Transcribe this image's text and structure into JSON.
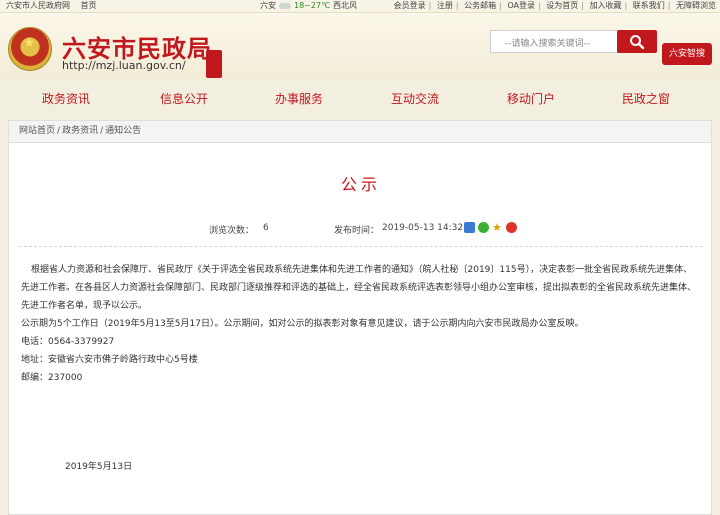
{
  "topbar": {
    "gov_site": "六安市人民政府网",
    "home": "首页",
    "city": "六安",
    "temp": "18~27℃",
    "wind": "西北风",
    "links": [
      "会员登录",
      "注册",
      "公务邮箱",
      "OA登录",
      "设为首页",
      "加入收藏",
      "联系我们",
      "无障碍浏览"
    ]
  },
  "header": {
    "title": "六安市民政局",
    "url": "http://mzj.luan.gov.cn/",
    "search_placeholder": "--请输入搜索关键词--",
    "zhitou_label": "六安智搜"
  },
  "nav": {
    "items": [
      "政务资讯",
      "信息公开",
      "办事服务",
      "互动交流",
      "移动门户",
      "民政之窗"
    ]
  },
  "breadcrumb": {
    "items": [
      "网站首页",
      "政务资讯",
      "通知公告"
    ],
    "separator": "/"
  },
  "article": {
    "title": "公示",
    "views_label": "浏览次数：",
    "views_value": "6",
    "publish_label": "发布时间：",
    "publish_value": "2019-05-13 14:32",
    "para1_line1": "根据省人力资源和社会保障厅、省民政厅《关于评选全省民政系统先进集体和先进工作者的通知》（皖人社秘〔2019〕115号），决定表彰一批全省民政系统先进集体、",
    "para1_line2": "先进工作者。在各县区人力资源社会保障部门、民政部门逐级推荐和评选的基础上，经全省民政系统评选表彰领导小组办公室审核，提出拟表彰的全省民政系统先进集体、",
    "para1_line3": "先进工作者名单，现予以公示。",
    "para2": "公示期为5个工作日（2019年5月13至5月17日）。公示期间，如对公示的拟表彰对象有意见建议，请于公示期内向六安市民政局办公室反映。",
    "phone": "电话：0564-3379927",
    "address": "地址：安徽省六安市佛子岭路行政中心5号楼",
    "postcode": "邮编：237000",
    "sign_date": "2019年5月13日"
  },
  "colors": {
    "brand_red": "#c1181d",
    "page_bg": "#f3efe0"
  }
}
